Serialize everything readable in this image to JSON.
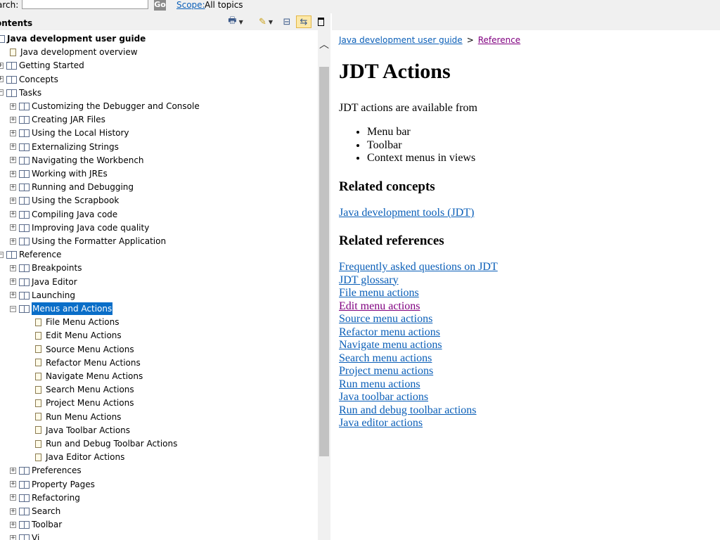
{
  "search": {
    "label": "arch:",
    "placeholder": "",
    "go": "Go",
    "scope_link": "Scope:",
    "scope_value": "All topics"
  },
  "contents": {
    "title": "ontents"
  },
  "toolbar": {
    "print_icon": "printer-icon",
    "highlight_icon": "highlight-icon",
    "collapse_icon": "collapse-all-icon",
    "link_icon": "link-with-contents-icon",
    "maximize_icon": "maximize-icon"
  },
  "tree": [
    {
      "label": "Java development user guide",
      "icon": "book",
      "expander": "",
      "bold": true,
      "selected": false
    },
    {
      "label": "Java development overview",
      "icon": "page",
      "expander": "",
      "bold": false,
      "selected": false
    },
    {
      "label": "Getting Started",
      "icon": "book",
      "expander": "+",
      "bold": false,
      "selected": false
    },
    {
      "label": "Concepts",
      "icon": "book",
      "expander": "+",
      "bold": false,
      "selected": false
    },
    {
      "label": "Tasks",
      "icon": "book",
      "expander": "-",
      "bold": false,
      "selected": false
    },
    {
      "label": "Customizing the Debugger and Console",
      "icon": "book",
      "expander": "+",
      "bold": false,
      "selected": false
    },
    {
      "label": "Creating JAR Files",
      "icon": "book",
      "expander": "+",
      "bold": false,
      "selected": false
    },
    {
      "label": "Using the Local History",
      "icon": "book",
      "expander": "+",
      "bold": false,
      "selected": false
    },
    {
      "label": "Externalizing Strings",
      "icon": "book",
      "expander": "+",
      "bold": false,
      "selected": false
    },
    {
      "label": "Navigating the Workbench",
      "icon": "book",
      "expander": "+",
      "bold": false,
      "selected": false
    },
    {
      "label": "Working with JREs",
      "icon": "book",
      "expander": "+",
      "bold": false,
      "selected": false
    },
    {
      "label": "Running and Debugging",
      "icon": "book",
      "expander": "+",
      "bold": false,
      "selected": false
    },
    {
      "label": "Using the Scrapbook",
      "icon": "book",
      "expander": "+",
      "bold": false,
      "selected": false
    },
    {
      "label": "Compiling Java code",
      "icon": "book",
      "expander": "+",
      "bold": false,
      "selected": false
    },
    {
      "label": "Improving Java code quality",
      "icon": "book",
      "expander": "+",
      "bold": false,
      "selected": false
    },
    {
      "label": "Using the Formatter Application",
      "icon": "book",
      "expander": "+",
      "bold": false,
      "selected": false
    },
    {
      "label": "Reference",
      "icon": "book",
      "expander": "-",
      "bold": false,
      "selected": false
    },
    {
      "label": "Breakpoints",
      "icon": "book",
      "expander": "+",
      "bold": false,
      "selected": false
    },
    {
      "label": "Java Editor",
      "icon": "book",
      "expander": "+",
      "bold": false,
      "selected": false
    },
    {
      "label": "Launching",
      "icon": "book",
      "expander": "+",
      "bold": false,
      "selected": false
    },
    {
      "label": "Menus and Actions",
      "icon": "book",
      "expander": "-",
      "bold": false,
      "selected": true
    },
    {
      "label": "File Menu Actions",
      "icon": "page",
      "expander": "",
      "bold": false,
      "selected": false
    },
    {
      "label": "Edit Menu Actions",
      "icon": "page",
      "expander": "",
      "bold": false,
      "selected": false
    },
    {
      "label": "Source Menu Actions",
      "icon": "page",
      "expander": "",
      "bold": false,
      "selected": false
    },
    {
      "label": "Refactor Menu Actions",
      "icon": "page",
      "expander": "",
      "bold": false,
      "selected": false
    },
    {
      "label": "Navigate Menu Actions",
      "icon": "page",
      "expander": "",
      "bold": false,
      "selected": false
    },
    {
      "label": "Search Menu Actions",
      "icon": "page",
      "expander": "",
      "bold": false,
      "selected": false
    },
    {
      "label": "Project Menu Actions",
      "icon": "page",
      "expander": "",
      "bold": false,
      "selected": false
    },
    {
      "label": "Run Menu Actions",
      "icon": "page",
      "expander": "",
      "bold": false,
      "selected": false
    },
    {
      "label": "Java Toolbar Actions",
      "icon": "page",
      "expander": "",
      "bold": false,
      "selected": false
    },
    {
      "label": "Run and Debug Toolbar Actions",
      "icon": "page",
      "expander": "",
      "bold": false,
      "selected": false
    },
    {
      "label": "Java Editor Actions",
      "icon": "page",
      "expander": "",
      "bold": false,
      "selected": false
    },
    {
      "label": "Preferences",
      "icon": "book",
      "expander": "+",
      "bold": false,
      "selected": false
    },
    {
      "label": "Property Pages",
      "icon": "book",
      "expander": "+",
      "bold": false,
      "selected": false
    },
    {
      "label": "Refactoring",
      "icon": "book",
      "expander": "+",
      "bold": false,
      "selected": false
    },
    {
      "label": "Search",
      "icon": "book",
      "expander": "+",
      "bold": false,
      "selected": false
    },
    {
      "label": "Toolbar",
      "icon": "book",
      "expander": "+",
      "bold": false,
      "selected": false
    },
    {
      "label": "Vi",
      "icon": "book",
      "expander": "+",
      "bold": false,
      "selected": false
    }
  ],
  "breadcrumb": {
    "first": "Java development user guide",
    "sep": ">",
    "second": "Reference"
  },
  "content": {
    "title": "JDT Actions",
    "intro": "JDT actions are available from",
    "bullets": [
      "Menu bar",
      "Toolbar",
      "Context menus in views"
    ],
    "related_concepts_heading": "Related concepts",
    "related_concepts": [
      "Java development tools (JDT)"
    ],
    "related_references_heading": "Related references",
    "related_references": [
      {
        "label": "Frequently asked questions on JDT",
        "visited": false
      },
      {
        "label": "JDT glossary",
        "visited": false
      },
      {
        "label": "File menu actions",
        "visited": false
      },
      {
        "label": "Edit menu actions",
        "visited": true
      },
      {
        "label": "Source menu actions",
        "visited": false
      },
      {
        "label": "Refactor menu actions",
        "visited": false
      },
      {
        "label": "Navigate menu actions",
        "visited": false
      },
      {
        "label": "Search menu actions",
        "visited": false
      },
      {
        "label": "Project menu actions",
        "visited": false
      },
      {
        "label": "Run menu actions",
        "visited": false
      },
      {
        "label": "Java toolbar actions",
        "visited": false
      },
      {
        "label": "Run and debug toolbar actions",
        "visited": false
      },
      {
        "label": "Java editor actions",
        "visited": false
      }
    ]
  },
  "colors": {
    "link": "#0b5fb8",
    "visited": "#800080",
    "selection": "#0a6ec8",
    "chrome": "#f0f0f0"
  }
}
